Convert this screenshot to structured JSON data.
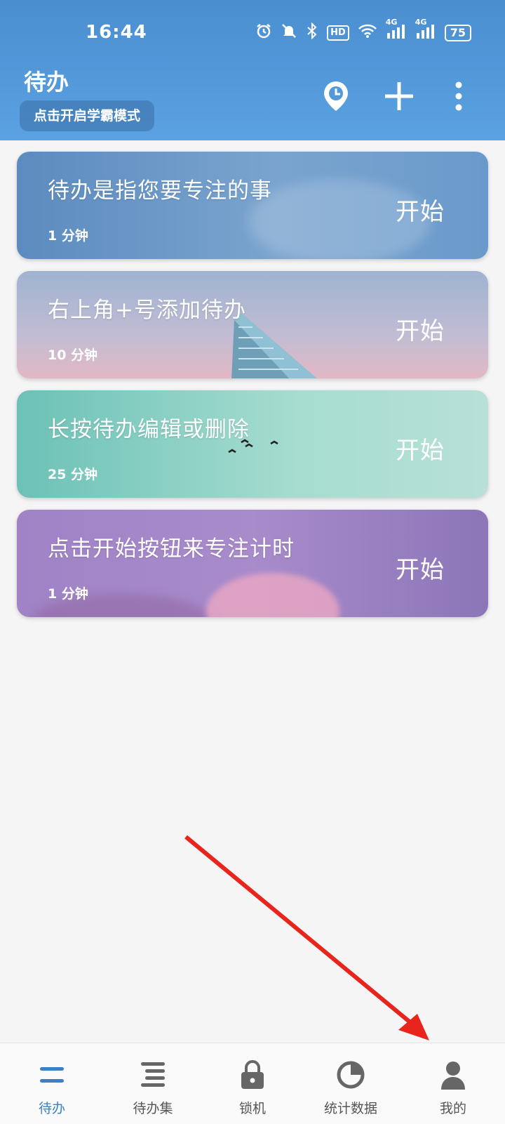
{
  "status_bar": {
    "time": "16:44",
    "battery": "75",
    "hd_label": "HD",
    "signal_label_1": "4G",
    "signal_label_2": "4G"
  },
  "header": {
    "title": "待办",
    "mode_button": "点击开启学霸模式"
  },
  "todos": [
    {
      "title": "待办是指您要专注的事",
      "duration": "1 分钟",
      "start": "开始"
    },
    {
      "title": "右上角+号添加待办",
      "duration": "10 分钟",
      "start": "开始"
    },
    {
      "title": "长按待办编辑或删除",
      "duration": "25 分钟",
      "start": "开始"
    },
    {
      "title": "点击开始按钮来专注计时",
      "duration": "1 分钟",
      "start": "开始"
    }
  ],
  "nav": [
    {
      "label": "待办",
      "icon": "todo-icon",
      "active": true
    },
    {
      "label": "待办集",
      "icon": "todo-set-icon",
      "active": false
    },
    {
      "label": "锁机",
      "icon": "lock-icon",
      "active": false
    },
    {
      "label": "统计数据",
      "icon": "pie-chart-icon",
      "active": false
    },
    {
      "label": "我的",
      "icon": "user-icon",
      "active": false
    }
  ],
  "colors": {
    "header": "#4a8ed0",
    "active": "#3d7fc4",
    "inactive": "#555555",
    "arrow": "#e8241c"
  }
}
